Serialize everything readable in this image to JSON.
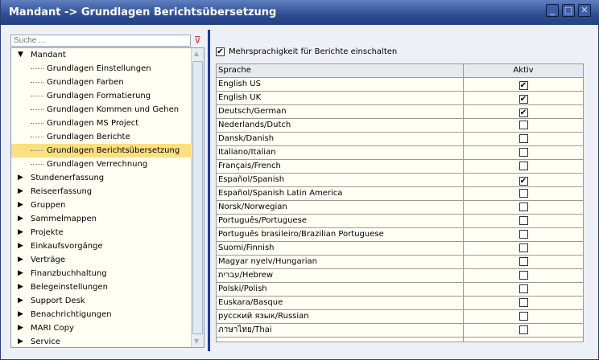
{
  "window": {
    "title": "Mandant -> Grundlagen Berichtsübersetzung",
    "minimize": "_",
    "maximize": "□",
    "close": "✕"
  },
  "search": {
    "placeholder": "Suche ..."
  },
  "tree": [
    {
      "label": "Mandant",
      "level": 0,
      "expanded": true
    },
    {
      "label": "Grundlagen Einstellungen",
      "level": 1
    },
    {
      "label": "Grundlagen Farben",
      "level": 1
    },
    {
      "label": "Grundlagen Formatierung",
      "level": 1
    },
    {
      "label": "Grundlagen Kommen und Gehen",
      "level": 1
    },
    {
      "label": "Grundlagen MS Project",
      "level": 1
    },
    {
      "label": "Grundlagen Berichte",
      "level": 1
    },
    {
      "label": "Grundlagen Berichtsübersetzung",
      "level": 1,
      "selected": true
    },
    {
      "label": "Grundlagen Verrechnung",
      "level": 1
    },
    {
      "label": "Stundenerfassung",
      "level": 0
    },
    {
      "label": "Reiseerfassung",
      "level": 0
    },
    {
      "label": "Gruppen",
      "level": 0
    },
    {
      "label": "Sammelmappen",
      "level": 0
    },
    {
      "label": "Projekte",
      "level": 0
    },
    {
      "label": "Einkaufsvorgänge",
      "level": 0
    },
    {
      "label": "Verträge",
      "level": 0
    },
    {
      "label": "Finanzbuchhaltung",
      "level": 0
    },
    {
      "label": "Belegeinstellungen",
      "level": 0
    },
    {
      "label": "Support Desk",
      "level": 0
    },
    {
      "label": "Benachrichtigungen",
      "level": 0
    },
    {
      "label": "MARI Copy",
      "level": 0
    },
    {
      "label": "Service",
      "level": 0
    }
  ],
  "multilang": {
    "label": "Mehrsprachigkeit für Berichte einschalten",
    "checked": true
  },
  "table": {
    "headers": [
      "Sprache",
      "Aktiv"
    ],
    "rows": [
      {
        "lang": "English US",
        "active": true
      },
      {
        "lang": "English UK",
        "active": true
      },
      {
        "lang": "Deutsch/German",
        "active": true
      },
      {
        "lang": "Nederlands/Dutch",
        "active": false
      },
      {
        "lang": "Dansk/Danish",
        "active": false
      },
      {
        "lang": "Italiano/Italian",
        "active": false
      },
      {
        "lang": "Français/French",
        "active": false
      },
      {
        "lang": "Español/Spanish",
        "active": true
      },
      {
        "lang": "Español/Spanish Latin America",
        "active": false
      },
      {
        "lang": "Norsk/Norwegian",
        "active": false
      },
      {
        "lang": "Português/Portuguese",
        "active": false
      },
      {
        "lang": "Português brasileiro/Brazilian Portuguese",
        "active": false
      },
      {
        "lang": "Suomi/Finnish",
        "active": false
      },
      {
        "lang": "Magyar nyelv/Hungarian",
        "active": false
      },
      {
        "lang": "עברית/Hebrew",
        "active": false
      },
      {
        "lang": "Polski/Polish",
        "active": false
      },
      {
        "lang": "Euskara/Basque",
        "active": false
      },
      {
        "lang": "русский язык/Russian",
        "active": false
      },
      {
        "lang": "ภาษาไทย/Thai",
        "active": false
      }
    ]
  }
}
